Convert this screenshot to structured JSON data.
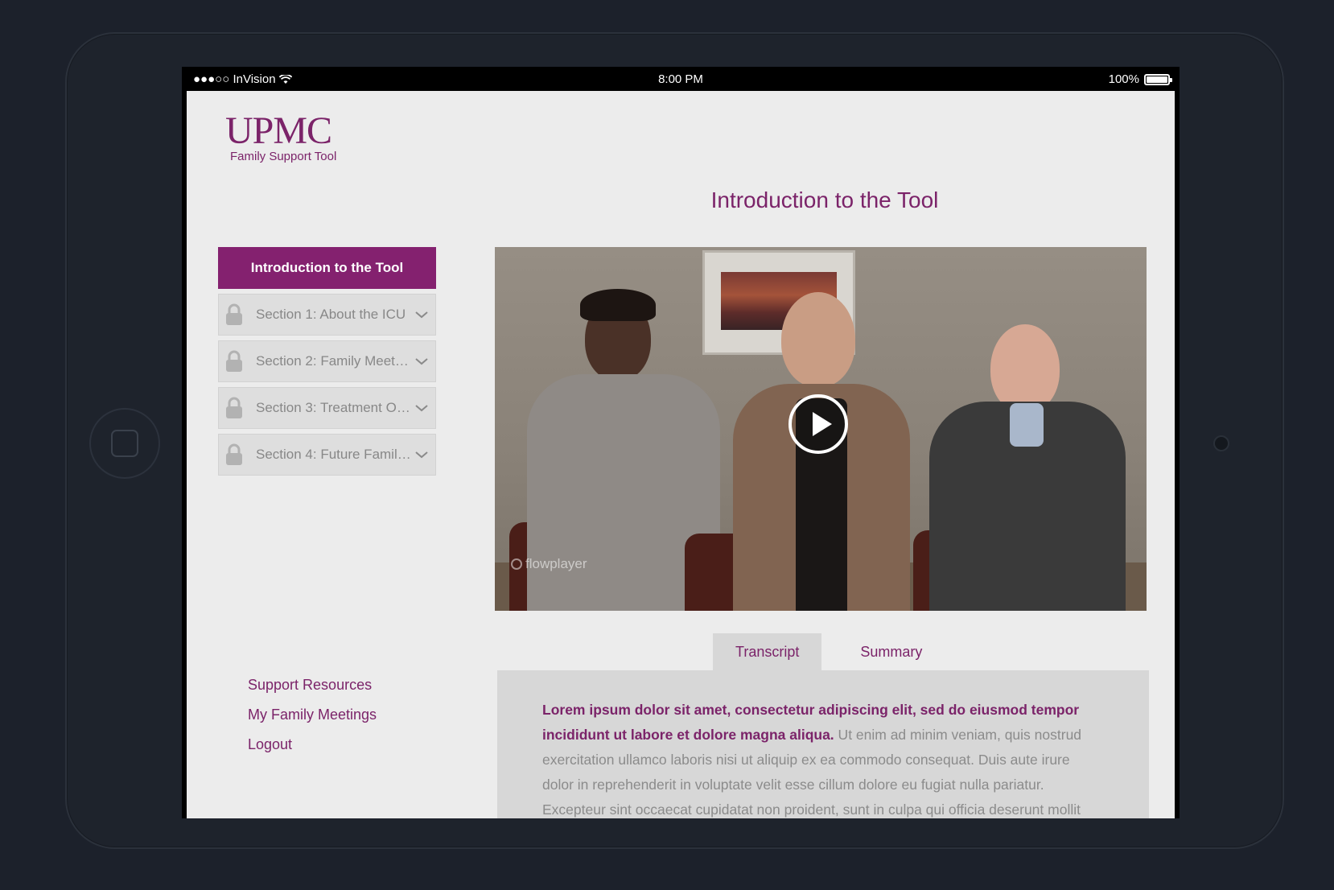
{
  "status_bar": {
    "carrier": "●●●○○ InVision",
    "time": "8:00 PM",
    "battery": "100%",
    "battery_level": 1.0
  },
  "logo": {
    "wordmark": "UPMC",
    "subtitle": "Family Support Tool"
  },
  "page_title": "Introduction to the Tool",
  "sidebar": {
    "active_item": "Introduction to the Tool",
    "items": [
      {
        "label": "Section 1: About the ICU",
        "icon": "lock-icon"
      },
      {
        "label": "Section 2: Family Meeting...",
        "icon": "lock-icon"
      },
      {
        "label": "Section 3: Treatment Opt...",
        "icon": "lock-icon"
      },
      {
        "label": "Section 4: Future Family...",
        "icon": "lock-icon"
      }
    ]
  },
  "footer_links": [
    "Support Resources",
    "My Family Meetings",
    "Logout"
  ],
  "video": {
    "player_brand": "flowplayer",
    "play_icon": "play-icon"
  },
  "tabs": [
    {
      "label": "Transcript",
      "active": true
    },
    {
      "label": "Summary",
      "active": false
    }
  ],
  "transcript": {
    "lead": "Lorem ipsum dolor sit amet, consectetur adipiscing elit, sed do eiusmod tempor incididunt ut labore et dolore magna aliqua.",
    "body": " Ut enim ad minim veniam, quis nostrud exercitation ullamco laboris nisi ut aliquip ex ea commodo consequat. Duis aute irure dolor in reprehenderit in voluptate velit esse cillum dolore eu fugiat nulla pariatur. Excepteur sint occaecat cupidatat non proident, sunt in culpa qui officia deserunt mollit"
  },
  "colors": {
    "brand": "#7b2369",
    "active_nav": "#84216f",
    "background": "#ececec"
  }
}
